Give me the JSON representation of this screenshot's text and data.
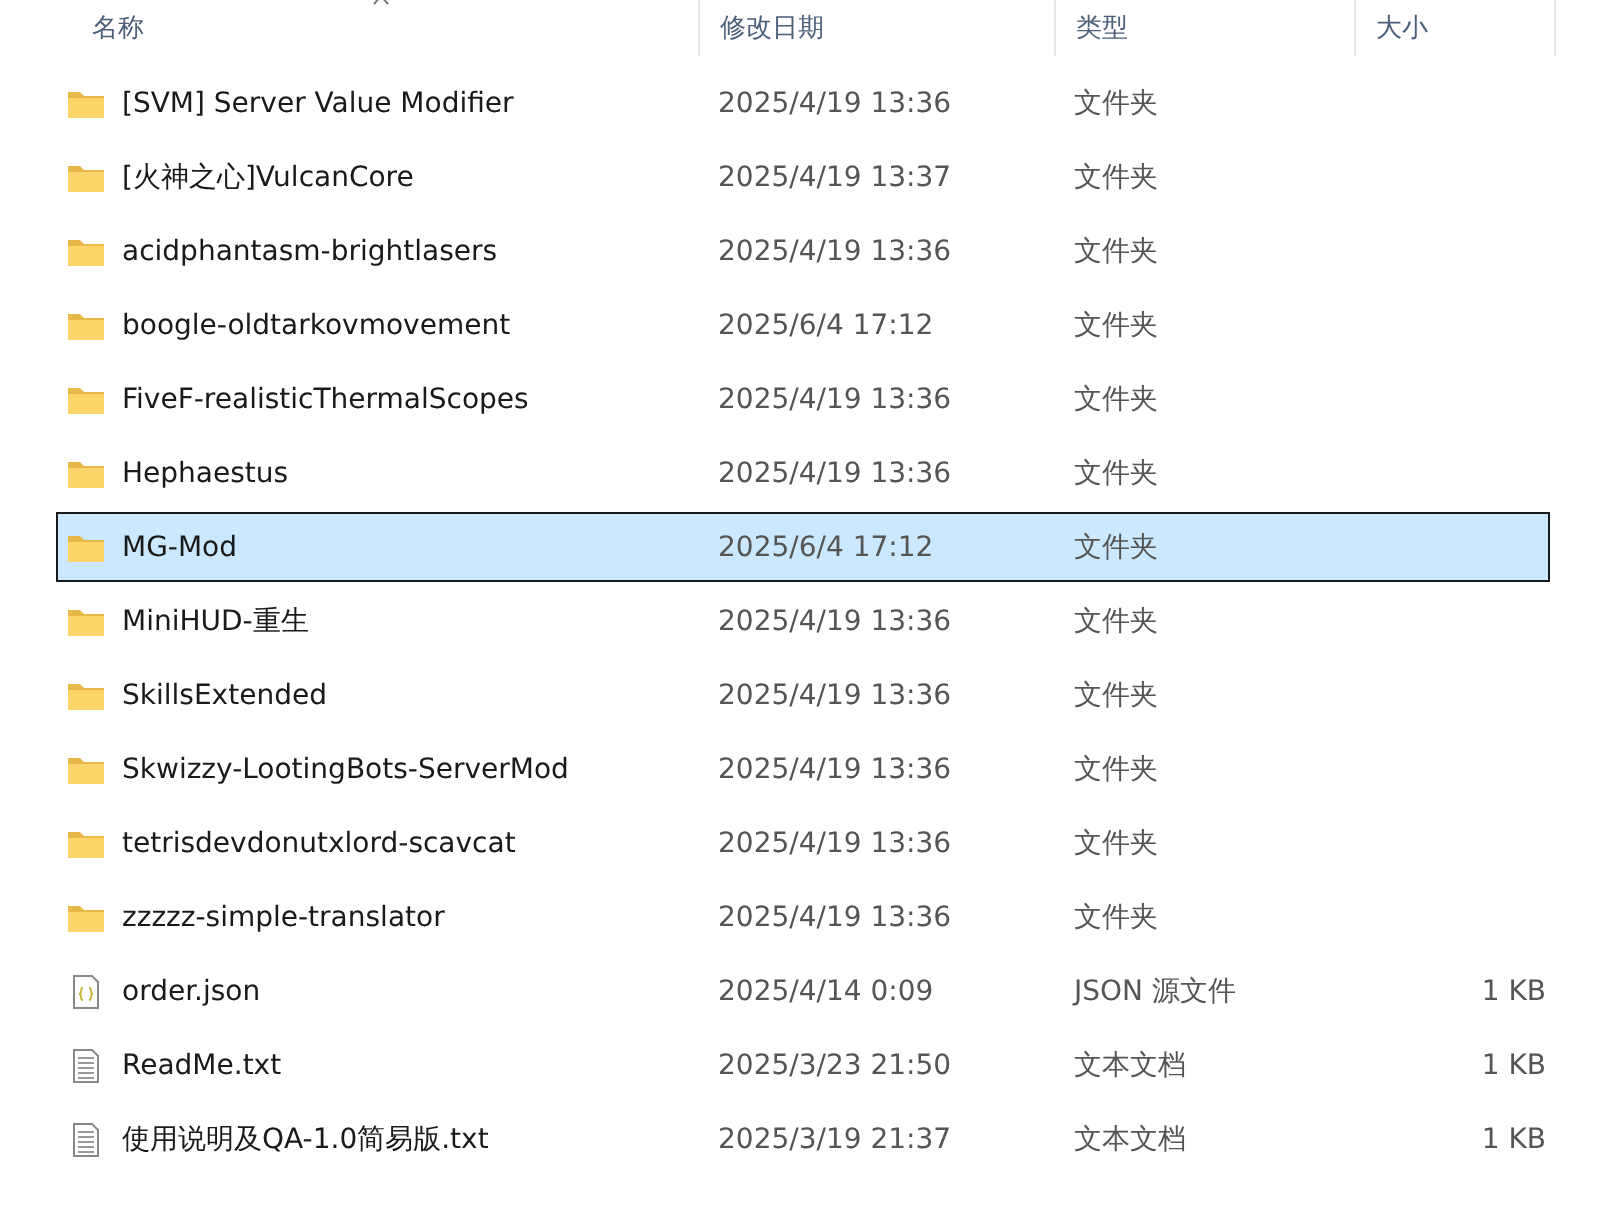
{
  "table": {
    "columns": [
      "名称",
      "修改日期",
      "类型",
      "大小"
    ],
    "rows": [
      {
        "kind": "folder",
        "name": "[SVM] Server Value Modifier",
        "modified": "2025/4/19 13:36",
        "type": "文件夹",
        "selected": false
      },
      {
        "kind": "folder",
        "name": "[火神之心]VulcanCore",
        "modified": "2025/4/19 13:37",
        "type": "文件夹",
        "selected": false
      },
      {
        "kind": "folder",
        "name": "acidphantasm-brightlasers",
        "modified": "2025/4/19 13:36",
        "type": "文件夹",
        "selected": false
      },
      {
        "kind": "folder",
        "name": "boogle-oldtarkovmovement",
        "modified": "2025/6/4 17:12",
        "type": "文件夹",
        "selected": false
      },
      {
        "kind": "folder",
        "name": "FiveF-realisticThermalScopes",
        "modified": "2025/4/19 13:36",
        "type": "文件夹",
        "selected": false
      },
      {
        "kind": "folder",
        "name": "Hephaestus",
        "modified": "2025/4/19 13:36",
        "type": "文件夹",
        "selected": false
      },
      {
        "kind": "folder",
        "name": "MG-Mod",
        "modified": "2025/6/4 17:12",
        "type": "文件夹",
        "selected": true
      },
      {
        "kind": "folder",
        "name": "MiniHUD-重生",
        "modified": "2025/4/19 13:36",
        "type": "文件夹",
        "selected": false
      },
      {
        "kind": "folder",
        "name": "SkillsExtended",
        "modified": "2025/4/19 13:36",
        "type": "文件夹",
        "selected": false
      },
      {
        "kind": "folder",
        "name": "Skwizzy-LootingBots-ServerMod",
        "modified": "2025/4/19 13:36",
        "type": "文件夹",
        "selected": false
      },
      {
        "kind": "folder",
        "name": "tetrisdevdonutxlord-scavcat",
        "modified": "2025/4/19 13:36",
        "type": "文件夹",
        "selected": false
      },
      {
        "kind": "folder",
        "name": "zzzzz-simple-translator",
        "modified": "2025/4/19 13:36",
        "type": "文件夹",
        "selected": false
      },
      {
        "kind": "json",
        "name": "order.json",
        "modified": "2025/4/14 0:09",
        "type": "JSON 源文件",
        "size": "1 KB",
        "selected": false
      },
      {
        "kind": "text",
        "name": "ReadMe.txt",
        "modified": "2025/3/23 21:50",
        "type": "文本文档",
        "size": "1 KB",
        "selected": false
      },
      {
        "kind": "text",
        "name": "使用说明及QA-1.0简易版.txt",
        "modified": "2025/3/19 21:37",
        "type": "文本文档",
        "size": "1 KB",
        "selected": false
      }
    ]
  }
}
